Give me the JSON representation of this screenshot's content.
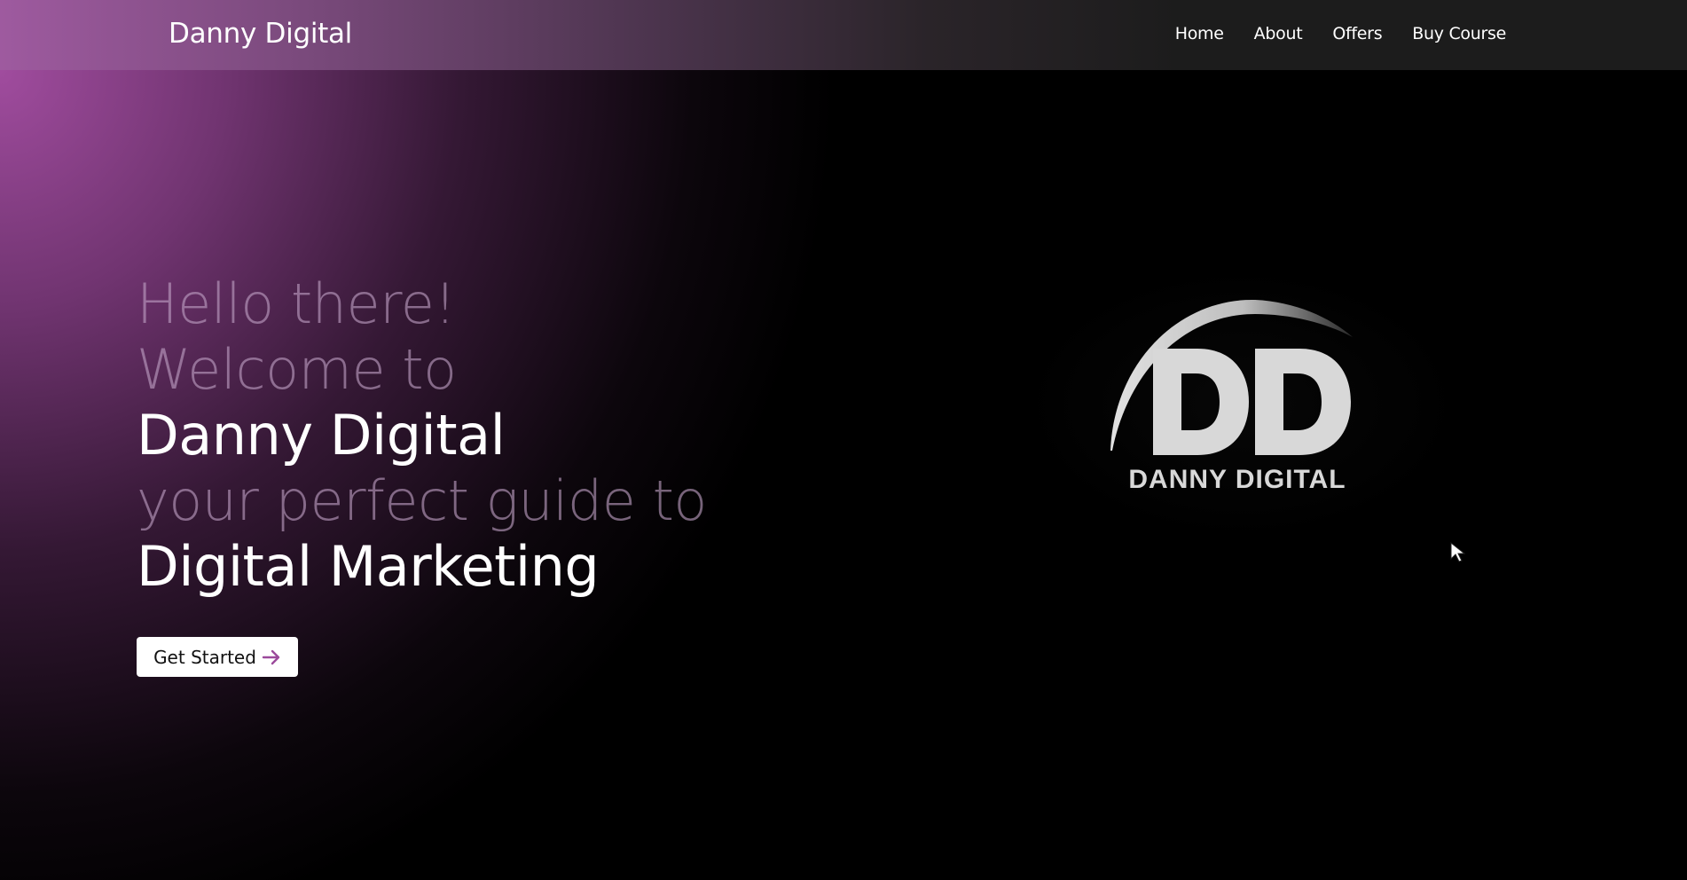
{
  "navbar": {
    "brand": "Danny Digital",
    "links": [
      {
        "label": "Home"
      },
      {
        "label": "About"
      },
      {
        "label": "Offers"
      },
      {
        "label": "Buy Course"
      }
    ]
  },
  "hero": {
    "lines": [
      "Hello there!",
      "Welcome to",
      "Danny Digital",
      "your perfect guide to",
      "Digital Marketing"
    ],
    "cta_label": "Get Started",
    "cta_icon": "arrow-right-icon"
  },
  "logo": {
    "monogram": "DD",
    "wordmark": "DANNY DIGITAL"
  },
  "colors": {
    "accent": "#9b4a9b",
    "nav_bg": "#1c1c1c",
    "background": "#000000",
    "logo_gray": "#d8d8d8"
  }
}
